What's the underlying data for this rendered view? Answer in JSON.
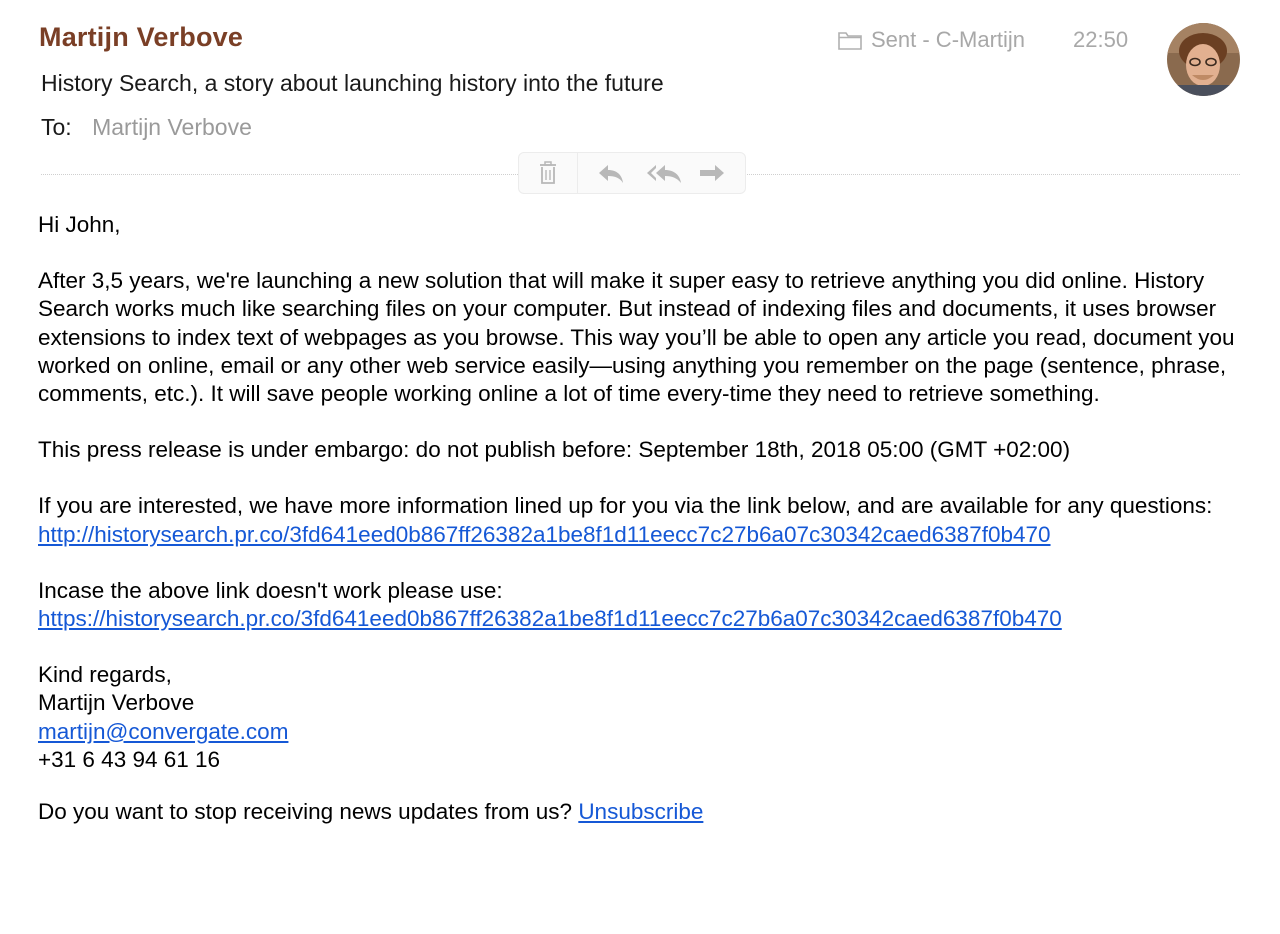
{
  "email": {
    "sender_name": "Martijn Verbove",
    "subject": "History Search, a story about launching history into the future",
    "to_label": "To:",
    "to_value": "Martijn Verbove",
    "mailbox": "Sent - C-Martijn",
    "time": "22:50"
  },
  "toolbar": {
    "icons": [
      "trash-icon",
      "reply-icon",
      "reply-all-icon",
      "forward-icon"
    ]
  },
  "body": {
    "greeting": "Hi John,",
    "paragraph1": "After 3,5 years, we're launching a new solution that will make it super easy to retrieve anything you did online. History Search works much like searching files on your computer. But instead of indexing files and documents, it uses browser extensions to index text of webpages as you browse. This way you’ll be able to open any article you read, document you worked on online, email or any other web service easily—using anything you remember on the page (sentence, phrase, comments, etc.). It will save people working online a lot of time every-time they need to retrieve something.",
    "embargo": "This press release is under embargo: do not publish before: September 18th, 2018 05:00 (GMT +02:00)",
    "info_text": "If you are interested, we have more information lined up for you via the link below, and are available for any questions:",
    "link_http": "http://historysearch.pr.co/3fd641eed0b867ff26382a1be8f1d11eecc7c27b6a07c30342caed6387f0b470",
    "incase_text": "Incase the above link doesn't work please use:",
    "link_https": "https://historysearch.pr.co/3fd641eed0b867ff26382a1be8f1d11eecc7c27b6a07c30342caed6387f0b470",
    "regards": "Kind regards,",
    "sig_name": "Martijn Verbove",
    "sig_email": "martijn@convergate.com",
    "sig_phone": "+31 6 43 94 61 16",
    "unsubscribe_prompt": "Do you want to stop receiving news updates from us?",
    "unsubscribe_link": "Unsubscribe"
  },
  "colors": {
    "sender": "#7a3f26",
    "link": "#1558d6",
    "muted": "#a8a8a8"
  }
}
